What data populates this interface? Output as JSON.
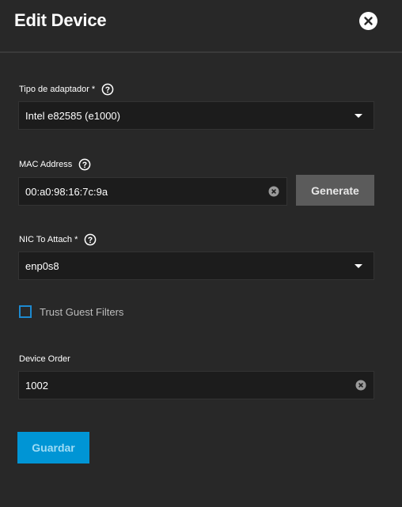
{
  "header": {
    "title": "Edit Device"
  },
  "form": {
    "adapter_type": {
      "label": "Tipo de adaptador",
      "required_mark": "*",
      "value": "Intel e82585 (e1000)"
    },
    "mac_address": {
      "label": "MAC Address",
      "value": "00:a0:98:16:7c:9a",
      "generate_label": "Generate"
    },
    "nic_to_attach": {
      "label": "NIC To Attach",
      "required_mark": "*",
      "value": "enp0s8"
    },
    "trust_guest_filters": {
      "label": "Trust Guest Filters",
      "checked": false
    },
    "device_order": {
      "label": "Device Order",
      "value": "1002"
    },
    "save_label": "Guardar"
  },
  "icons": {
    "close": "close-icon",
    "help": "help-circle-icon",
    "dropdown": "caret-down-icon",
    "clear": "clear-circle-icon"
  },
  "colors": {
    "background": "#282828",
    "field_background": "#1c1c1c",
    "accent": "#0095d5",
    "checkbox_border": "#1d8ad0",
    "generate_button": "#5b5b5b"
  }
}
